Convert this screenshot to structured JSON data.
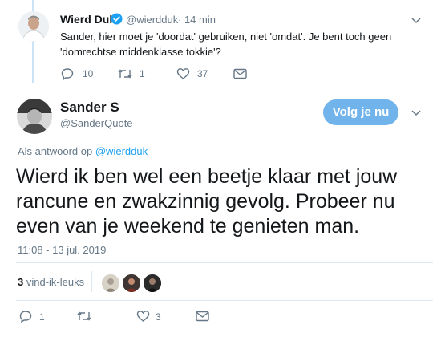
{
  "reply_tweet": {
    "author_name": "Wierd Duk",
    "author_handle": "@wierdduk",
    "time": "· 14 min",
    "text_line1": "Sander, hier moet je 'doordat' gebruiken, niet 'omdat'. Je bent toch geen",
    "text_line2": "'domrechtse middenklasse tokkie'?",
    "reply_count": "10",
    "retweet_count": "1",
    "like_count": "37"
  },
  "main_tweet": {
    "author_name": "Sander S",
    "author_handle": "@SanderQuote",
    "follow_label": "Volg je nu",
    "reply_to_prefix": "Als antwoord op",
    "reply_to_handle": "@wierdduk",
    "text": "Wierd ik ben wel een beetje klaar met jouw rancune en zwakzinnig gevolg. Probeer nu even van je weekend te genieten man.",
    "timestamp": "11:08 - 13 jul. 2019",
    "likes_count": "3",
    "likes_label": "vind-ik-leuks",
    "reply_count": "1",
    "retweet_count": "",
    "like_count": "3"
  },
  "colors": {
    "accent": "#1da1f2",
    "follow_bg": "#71b4ec",
    "muted": "#657786",
    "verified": "#1da1f2"
  },
  "icons": [
    "reply-icon",
    "retweet-icon",
    "heart-icon",
    "mail-icon",
    "chevron-down-icon",
    "verified-badge-icon"
  ]
}
